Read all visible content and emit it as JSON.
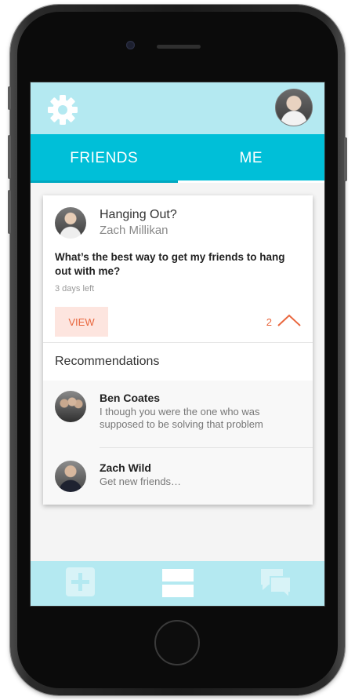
{
  "tabs": [
    {
      "label": "FRIENDS"
    },
    {
      "label": "ME"
    }
  ],
  "post": {
    "title": "Hanging Out?",
    "author": "Zach Millikan",
    "body": "What’s the best way to get my friends to hang out with me?",
    "time_left": "3 days left",
    "view_label": "VIEW",
    "count": "2"
  },
  "recommendations": {
    "heading": "Recommendations",
    "items": [
      {
        "name": "Ben Coates",
        "text": "I though you were the one who was supposed to be solving that problem"
      },
      {
        "name": "Zach Wild",
        "text": "Get new friends…"
      }
    ]
  },
  "colors": {
    "header_bg": "#b4e9f1",
    "tab_bg": "#00bfd8",
    "accent": "#e9673e"
  },
  "icons": {
    "settings": "gear-icon",
    "collapse": "chevron-up-icon",
    "add": "add-icon",
    "feed": "feed-icon",
    "chat": "chat-icon"
  }
}
